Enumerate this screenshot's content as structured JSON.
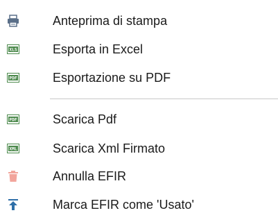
{
  "menu": {
    "items": [
      {
        "label": "Anteprima di stampa",
        "icon": "printer-icon"
      },
      {
        "label": "Esporta in Excel",
        "icon": "xls-file-icon"
      },
      {
        "label": "Esportazione su PDF",
        "icon": "pdf-file-icon"
      },
      {
        "label": "Scarica Pdf",
        "icon": "pdf-file-icon"
      },
      {
        "label": "Scarica Xml Firmato",
        "icon": "xml-file-icon"
      },
      {
        "label": "Annulla EFIR",
        "icon": "trash-icon"
      },
      {
        "label": "Marca EFIR come 'Usato'",
        "icon": "upload-arrow-icon"
      }
    ],
    "icon_texts": {
      "xls": "XLS",
      "pdf": "PDF",
      "xml": "XML"
    },
    "colors": {
      "printer": "#5a6f88",
      "file_green": "#4d8a4d",
      "trash": "#f2a59c",
      "arrow": "#2e6fa8",
      "separator": "#c8c8c8"
    }
  }
}
